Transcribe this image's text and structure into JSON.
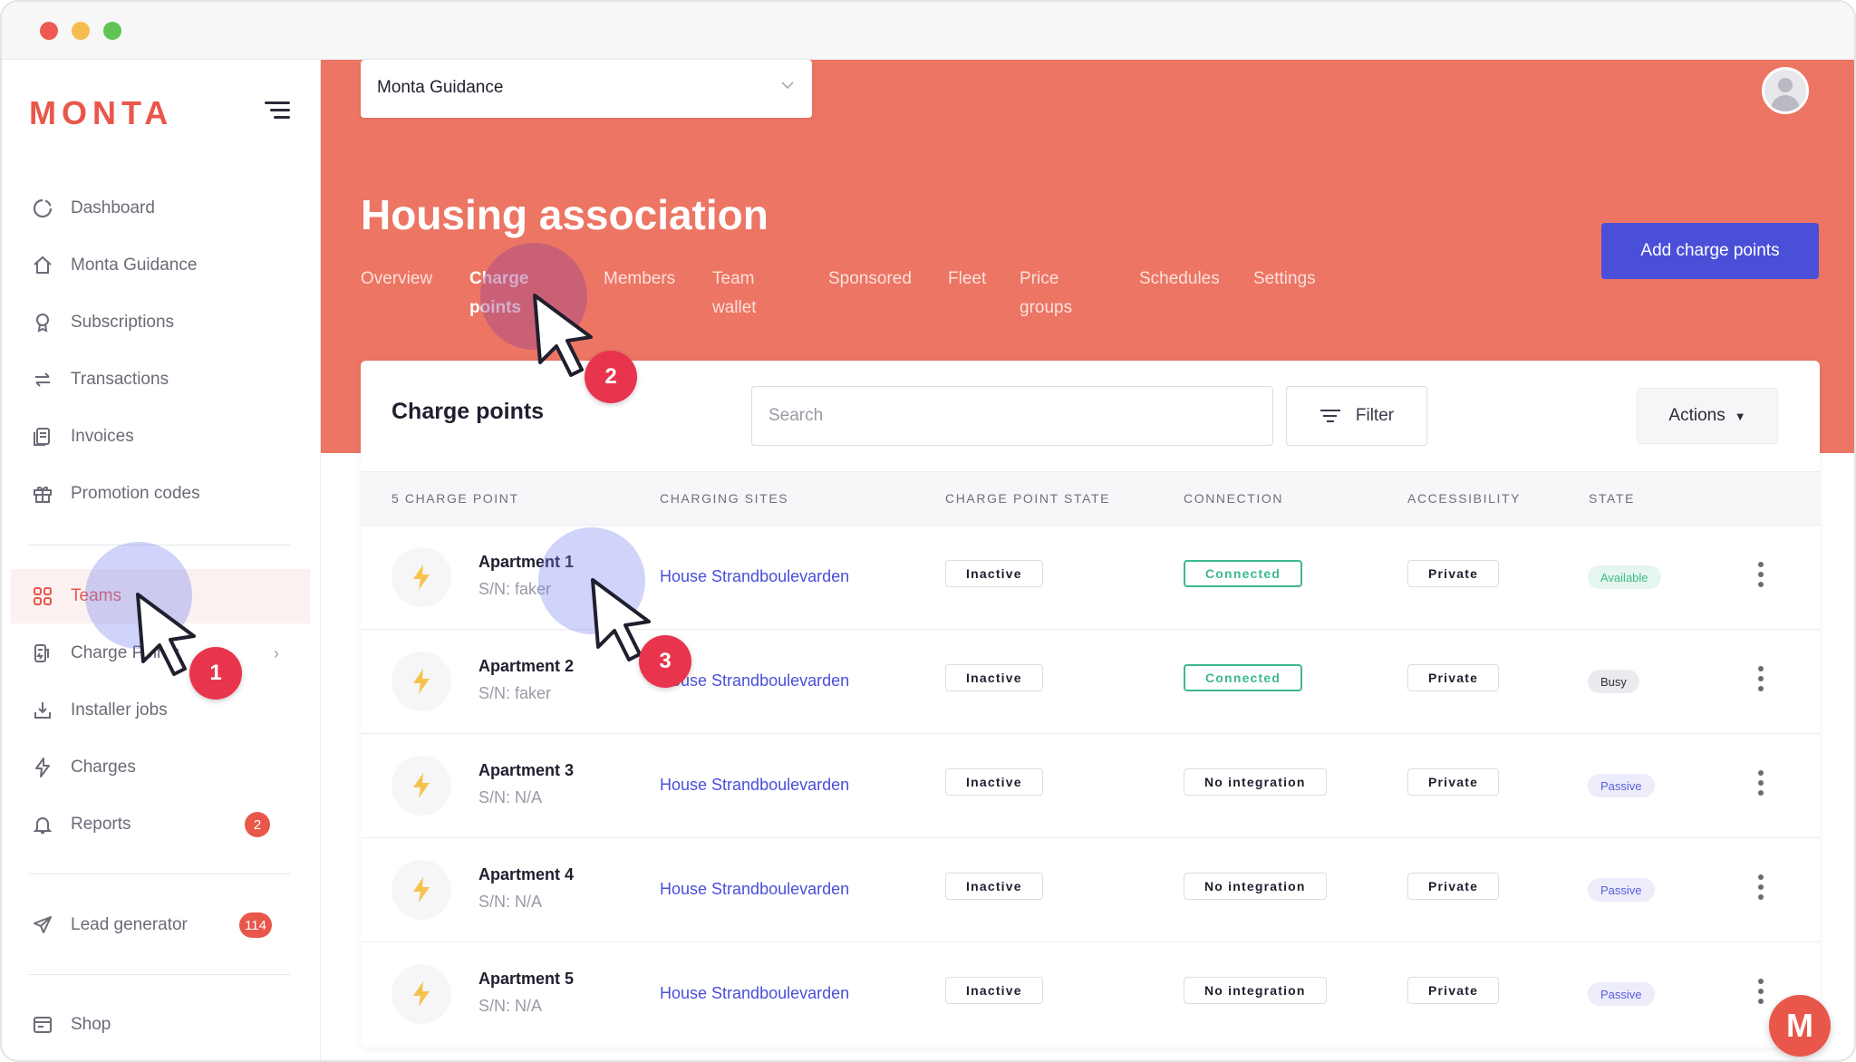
{
  "window": {
    "title_lights": [
      "close",
      "minimize",
      "maximize"
    ]
  },
  "sidebar": {
    "logo": "MONTA",
    "items": [
      {
        "label": "Dashboard",
        "icon": "dashboard-icon"
      },
      {
        "label": "Monta Guidance",
        "icon": "home-icon"
      },
      {
        "label": "Subscriptions",
        "icon": "badge-icon"
      },
      {
        "label": "Transactions",
        "icon": "arrows-icon"
      },
      {
        "label": "Invoices",
        "icon": "document-icon"
      },
      {
        "label": "Promotion codes",
        "icon": "gift-icon"
      },
      {
        "label": "Teams",
        "icon": "grid-icon",
        "active": true
      },
      {
        "label": "Charge Points",
        "icon": "charger-icon"
      },
      {
        "label": "Installer jobs",
        "icon": "download-icon"
      },
      {
        "label": "Charges",
        "icon": "bolt-icon"
      },
      {
        "label": "Reports",
        "icon": "bell-icon",
        "badge": "2"
      },
      {
        "label": "Lead generator",
        "icon": "send-icon",
        "badge": "114"
      },
      {
        "label": "Shop",
        "icon": "shop-icon"
      }
    ]
  },
  "header": {
    "org_select": {
      "value": "Monta Guidance"
    },
    "title": "Housing association",
    "tabs": [
      {
        "label": "Overview"
      },
      {
        "label": "Charge points",
        "active": true
      },
      {
        "label": "Members"
      },
      {
        "label": "Team wallet"
      },
      {
        "label": "Sponsored"
      },
      {
        "label": "Fleet"
      },
      {
        "label": "Price groups"
      },
      {
        "label": "Schedules"
      },
      {
        "label": "Settings"
      }
    ],
    "add_button": "Add charge points"
  },
  "card": {
    "title": "Charge points",
    "search_placeholder": "Search",
    "filter_label": "Filter",
    "actions_label": "Actions",
    "columns": [
      "5 CHARGE POINT",
      "CHARGING SITES",
      "CHARGE POINT STATE",
      "CONNECTION",
      "ACCESSIBILITY",
      "STATE"
    ],
    "rows": [
      {
        "name": "Apartment 1",
        "sn": "S/N: faker",
        "site": "House Strandboulevarden",
        "cp_state": "Inactive",
        "connection": "Connected",
        "accessibility": "Private",
        "state": "Available"
      },
      {
        "name": "Apartment 2",
        "sn": "S/N: faker",
        "site": "House Strandboulevarden",
        "cp_state": "Inactive",
        "connection": "Connected",
        "accessibility": "Private",
        "state": "Busy"
      },
      {
        "name": "Apartment 3",
        "sn": "S/N: N/A",
        "site": "House Strandboulevarden",
        "cp_state": "Inactive",
        "connection": "No integration",
        "accessibility": "Private",
        "state": "Passive"
      },
      {
        "name": "Apartment 4",
        "sn": "S/N: N/A",
        "site": "House Strandboulevarden",
        "cp_state": "Inactive",
        "connection": "No integration",
        "accessibility": "Private",
        "state": "Passive"
      },
      {
        "name": "Apartment 5",
        "sn": "S/N: N/A",
        "site": "House Strandboulevarden",
        "cp_state": "Inactive",
        "connection": "No integration",
        "accessibility": "Private",
        "state": "Passive"
      }
    ]
  },
  "steps": [
    "1",
    "2",
    "3"
  ],
  "help_fab": "M",
  "colors": {
    "brand": "#e8574a",
    "header_bg": "#ec7563",
    "primary": "#4a4fd8",
    "success": "#3cba8a"
  }
}
